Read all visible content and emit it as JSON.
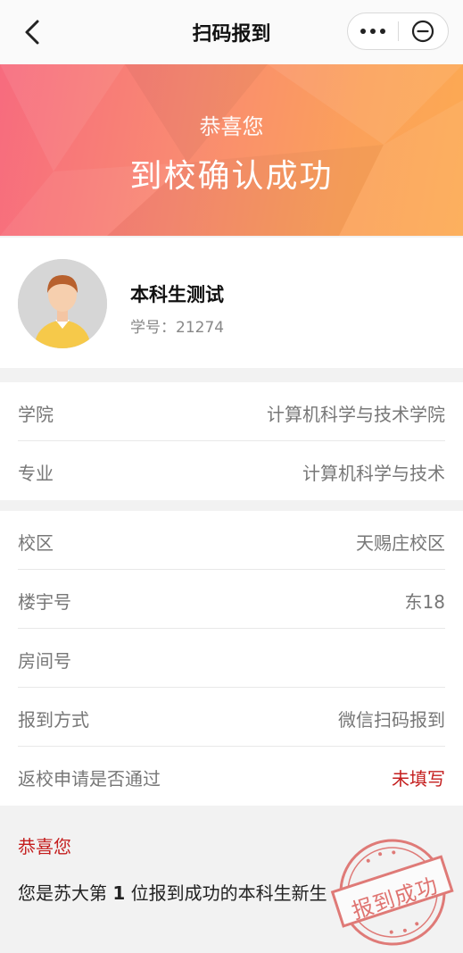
{
  "navbar": {
    "title": "扫码报到"
  },
  "banner": {
    "small": "恭喜您",
    "big": "到校确认成功"
  },
  "profile": {
    "name": "本科生测试",
    "student_id": "学号：21274"
  },
  "section1": [
    {
      "label": "学院",
      "value": "计算机科学与技术学院"
    },
    {
      "label": "专业",
      "value": "计算机科学与技术"
    }
  ],
  "section2": [
    {
      "label": "校区",
      "value": "天赐庄校区"
    },
    {
      "label": "楼宇号",
      "value": "东18"
    },
    {
      "label": "房间号",
      "value": ""
    },
    {
      "label": "报到方式",
      "value": "微信扫码报到"
    },
    {
      "label": "返校申请是否通过",
      "value": "未填写"
    }
  ],
  "bottom": {
    "congrats": "恭喜您",
    "msg_prefix": "您是苏大第",
    "rank": "1",
    "msg_suffix": "位报到成功的本科生新生",
    "stamp_text": "报到成功"
  },
  "colors": {
    "accent_red": "#c41e1e",
    "banner_left": "#f76b7e",
    "banner_right": "#fcaa52"
  }
}
